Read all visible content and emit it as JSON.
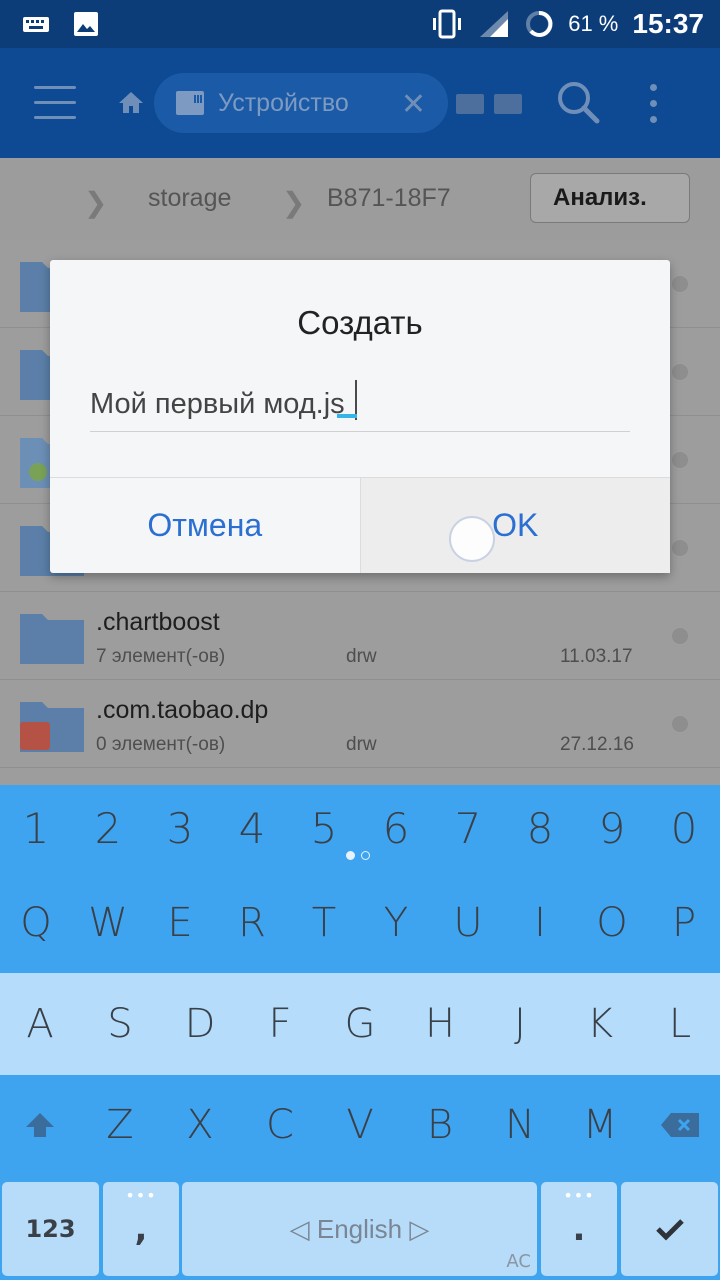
{
  "status_bar": {
    "battery_percent": "61 %",
    "time": "15:37",
    "icons": [
      "keyboard-icon",
      "image-icon",
      "vibrate-icon",
      "signal-icon",
      "battery-ring-icon"
    ]
  },
  "app_bar": {
    "location_chip": "Устройство",
    "icons": [
      "menu-icon",
      "home-icon",
      "sd-card-icon",
      "close-icon",
      "tab-icon",
      "search-icon",
      "more-vert-icon"
    ]
  },
  "breadcrumb": {
    "items": [
      "storage",
      "B871-18F7"
    ],
    "analyze_label": "Анализ."
  },
  "file_list": [
    {
      "name": ".chartboost",
      "count": "7 элемент(-ов)",
      "perm": "drw",
      "date": "11.03.17",
      "badge": "none"
    },
    {
      "name": ".com.taobao.dp",
      "count": "0 элемент(-ов)",
      "perm": "drw",
      "date": "27.12.16",
      "badge": "aliexpress-bag-icon"
    }
  ],
  "dialog": {
    "title": "Создать",
    "input_value": "Мой первый мод.js",
    "cancel_label": "Отмена",
    "ok_label": "OK"
  },
  "keyboard": {
    "numbers": [
      "1",
      "2",
      "3",
      "4",
      "5",
      "6",
      "7",
      "8",
      "9",
      "0"
    ],
    "row_q": [
      "Q",
      "W",
      "E",
      "R",
      "T",
      "Y",
      "U",
      "I",
      "O",
      "P"
    ],
    "row_a": [
      "A",
      "S",
      "D",
      "F",
      "G",
      "H",
      "J",
      "K",
      "L"
    ],
    "row_z": [
      "Z",
      "X",
      "C",
      "V",
      "B",
      "N",
      "M"
    ],
    "mode_key": "123",
    "comma_key": ",",
    "space_label": "◁ English ▷",
    "period_key": ".",
    "ac_mark": "AC",
    "colors": {
      "primary": "#3fa4f0",
      "light_row": "#b5ddfb",
      "key_bg": "#b6dcf9"
    }
  },
  "colors": {
    "status_bar": "#0d3d78",
    "app_bar": "#0e4a93",
    "accent_button": "#2a6fd1"
  }
}
